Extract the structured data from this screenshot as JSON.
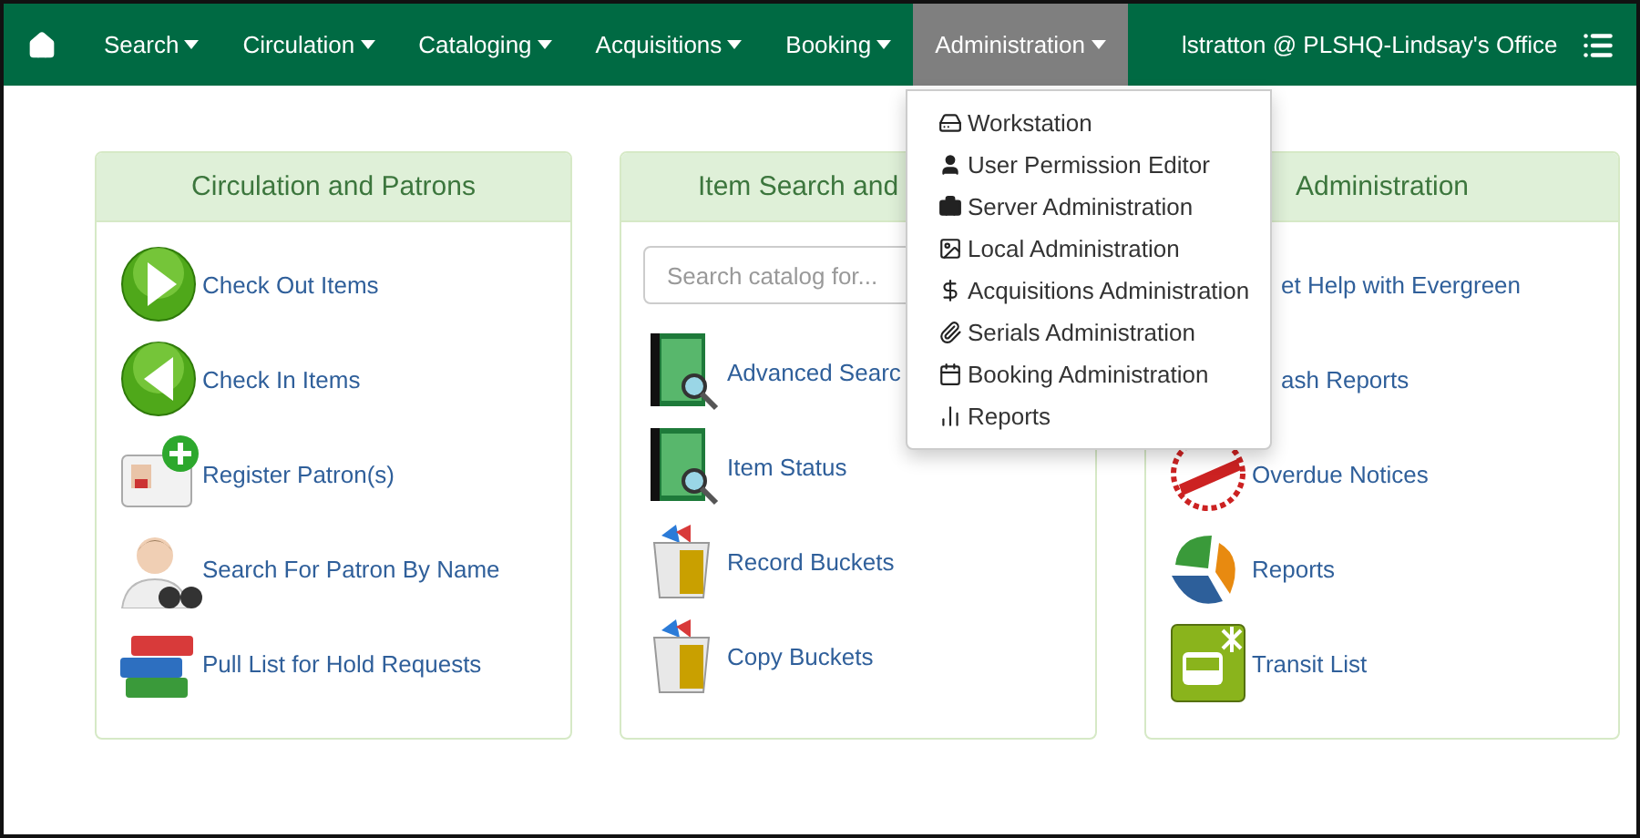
{
  "nav": {
    "items": [
      {
        "label": "Search",
        "selected": false
      },
      {
        "label": "Circulation",
        "selected": false
      },
      {
        "label": "Cataloging",
        "selected": false
      },
      {
        "label": "Acquisitions",
        "selected": false
      },
      {
        "label": "Booking",
        "selected": false
      },
      {
        "label": "Administration",
        "selected": true
      }
    ],
    "user": "lstratton @ PLSHQ-Lindsay's Office"
  },
  "cards": [
    {
      "title": "Circulation and Patrons",
      "items": [
        {
          "label": "Check Out Items",
          "kind": "play"
        },
        {
          "label": "Check In Items",
          "kind": "back"
        },
        {
          "label": "Register Patron(s)",
          "kind": "card"
        },
        {
          "label": "Search For Patron By Name",
          "kind": "person"
        },
        {
          "label": "Pull List for Hold Requests",
          "kind": "books"
        }
      ]
    },
    {
      "title": "Item Search and",
      "search_placeholder": "Search catalog for...",
      "items": [
        {
          "label": "Advanced Searc",
          "kind": "catalog"
        },
        {
          "label": "Item Status",
          "kind": "catalog"
        },
        {
          "label": "Record Buckets",
          "kind": "bucket"
        },
        {
          "label": "Copy Buckets",
          "kind": "bucket"
        }
      ]
    },
    {
      "title": "Administration",
      "items": [
        {
          "label": "et Help with Evergreen",
          "kind": "covered"
        },
        {
          "label": "ash Reports",
          "kind": "covered"
        },
        {
          "label": "Overdue Notices",
          "kind": "stamp"
        },
        {
          "label": "Reports",
          "kind": "pie"
        },
        {
          "label": "Transit List",
          "kind": "bus"
        }
      ]
    }
  ],
  "menu": {
    "items": [
      {
        "label": "Workstation",
        "kind": "workstation"
      },
      {
        "label": "User Permission Editor",
        "kind": "user"
      },
      {
        "label": "Server Administration",
        "kind": "briefcase"
      },
      {
        "label": "Local Administration",
        "kind": "image"
      },
      {
        "label": "Acquisitions Administration",
        "kind": "dollar"
      },
      {
        "label": "Serials Administration",
        "kind": "paperclip"
      },
      {
        "label": "Booking Administration",
        "kind": "calendar"
      },
      {
        "label": "Reports",
        "kind": "report"
      }
    ]
  }
}
